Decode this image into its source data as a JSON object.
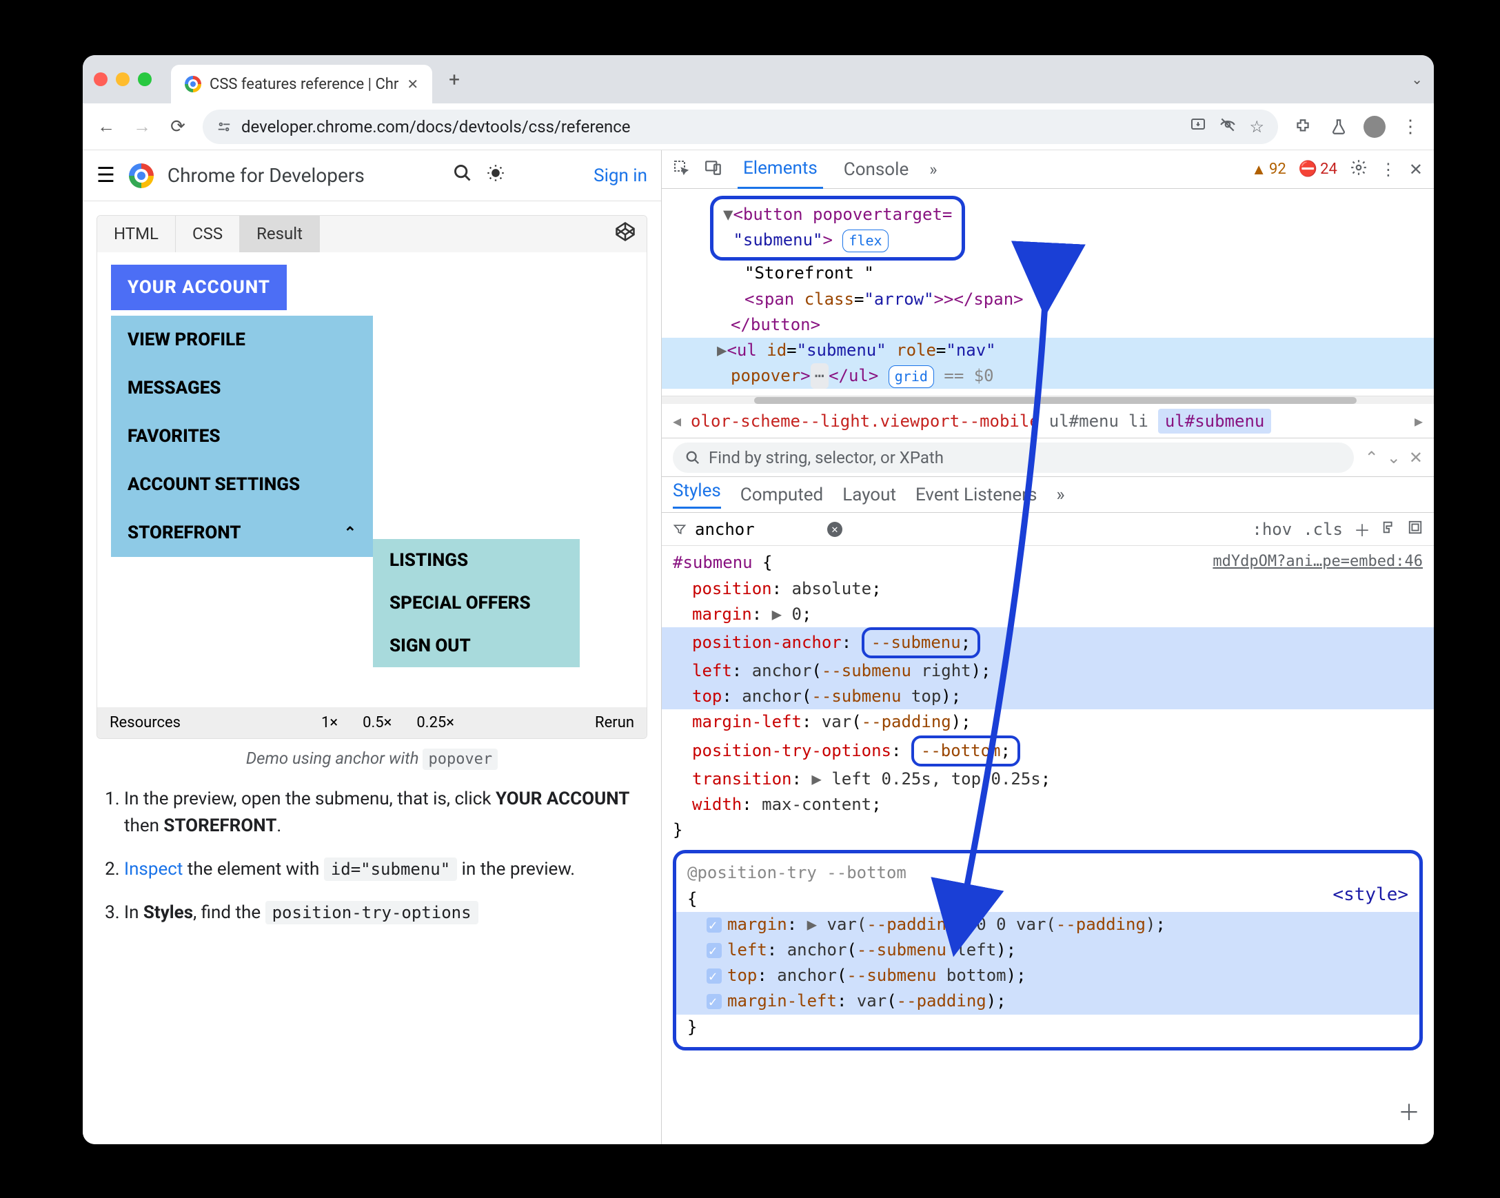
{
  "browser": {
    "tab_title": "CSS features reference  |  Chr",
    "url": "developer.chrome.com/docs/devtools/css/reference",
    "new_tab": "+"
  },
  "page_header": {
    "brand": "Chrome for Developers",
    "sign_in": "Sign in"
  },
  "demo": {
    "tabs": {
      "html": "HTML",
      "css": "CSS",
      "result": "Result"
    },
    "account_btn": "YOUR ACCOUNT",
    "menu1": [
      "VIEW PROFILE",
      "MESSAGES",
      "FAVORITES",
      "ACCOUNT SETTINGS",
      "STOREFRONT"
    ],
    "menu2": [
      "LISTINGS",
      "SPECIAL OFFERS",
      "SIGN OUT"
    ],
    "footer": {
      "resources": "Resources",
      "z1": "1×",
      "z05": "0.5×",
      "z025": "0.25×",
      "rerun": "Rerun"
    },
    "caption_pre": "Demo using anchor with ",
    "caption_code": "popover"
  },
  "steps": {
    "s1a": "In the preview, open the submenu, that is, click ",
    "s1b": "YOUR ACCOUNT",
    "s1c": " then ",
    "s1d": "STOREFRONT",
    "s1e": ".",
    "s2a": "Inspect",
    "s2b": " the element with ",
    "s2code": "id=\"submenu\"",
    "s2c": " in the preview.",
    "s3a": "In ",
    "s3b": "Styles",
    "s3c": ", find the ",
    "s3code": "position-try-options"
  },
  "devtools": {
    "tabs": {
      "elements": "Elements",
      "console": "Console"
    },
    "warn_count": "92",
    "err_count": "24",
    "dom": {
      "btn_open": "<button popovertarget=",
      "btn_val": "\"submenu\"",
      "btn_close": ">",
      "flex_badge": "flex",
      "txt": "\"Storefront \"",
      "span": "<span class=\"arrow\">></span>",
      "btn_end": "</button>",
      "ul_open": "<ul id=\"submenu\" role=\"nav\" popover>",
      "dots": "⋯",
      "ul_close": "</ul>",
      "grid_badge": "grid",
      "eq0": " == $0"
    },
    "breadcrumb": {
      "c1": "olor-scheme--light.viewport--mobile",
      "c2": "ul#menu",
      "c3": "li",
      "c4": "ul#submenu"
    },
    "search_placeholder": "Find by string, selector, or XPath",
    "styles_tabs": {
      "styles": "Styles",
      "computed": "Computed",
      "layout": "Layout",
      "event": "Event Listeners"
    },
    "filter_value": "anchor",
    "filter_hov": ":hov",
    "filter_cls": ".cls",
    "source_link": "mdYdpOM?ani…pe=embed:46",
    "css": {
      "selector": "#submenu",
      "r1": {
        "p": "position",
        "v": "absolute"
      },
      "r2": {
        "p": "margin",
        "v": "0"
      },
      "r3": {
        "p": "position-anchor",
        "v": "--submenu"
      },
      "r4": {
        "p": "left",
        "fn": "anchor",
        "var": "--submenu",
        "side": "right"
      },
      "r5": {
        "p": "top",
        "fn": "anchor",
        "var": "--submenu",
        "side": "top"
      },
      "r6": {
        "p": "margin-left",
        "fn": "var",
        "var": "--padding"
      },
      "r7": {
        "p": "position-try-options",
        "v": "--bottom"
      },
      "r8": {
        "p": "transition",
        "v": "left 0.25s, top 0.25s"
      },
      "r9": {
        "p": "width",
        "v": "max-content"
      }
    },
    "position_try": {
      "header": "@position-try --bottom",
      "style_link": "<style>",
      "r1": {
        "p": "margin",
        "pre": "var(",
        "var1": "--padding",
        "mid": ") 0 0 var(",
        "var2": "--padding",
        "post": ")"
      },
      "r2": {
        "p": "left",
        "fn": "anchor",
        "var": "--submenu",
        "side": "left"
      },
      "r3": {
        "p": "top",
        "fn": "anchor",
        "var": "--submenu",
        "side": "bottom"
      },
      "r4": {
        "p": "margin-left",
        "fn": "var",
        "var": "--padding"
      }
    }
  }
}
